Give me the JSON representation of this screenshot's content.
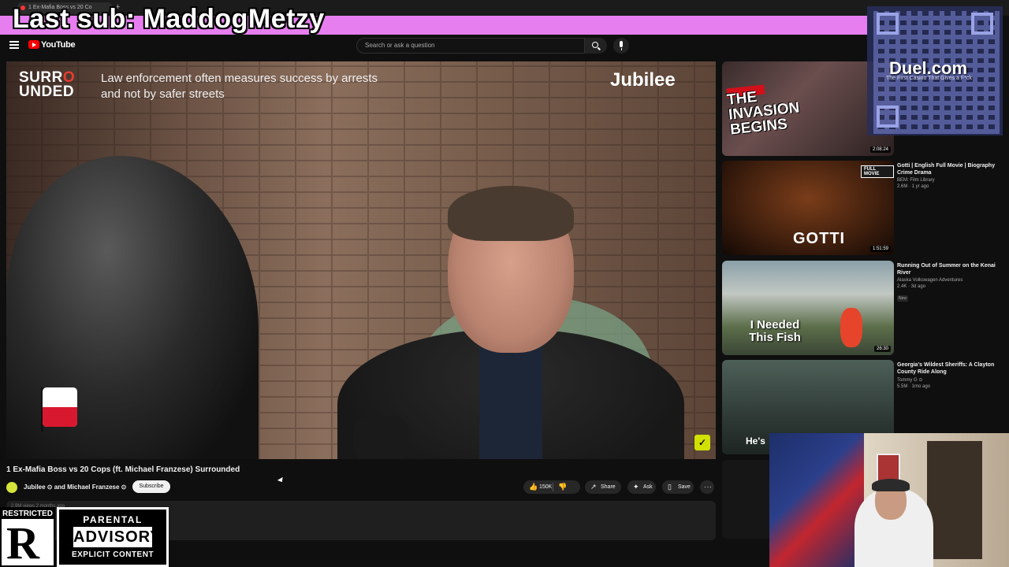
{
  "browser": {
    "tab_title": "1 Ex-Mafia Boss vs 20 Co",
    "new_tab_glyph": "+"
  },
  "stream_banner": {
    "text": "Last sub: MaddogMetzy",
    "color": "#e77ef0"
  },
  "header": {
    "brand": "YouTube",
    "search_placeholder": "Search or ask a question",
    "icons": [
      "menu-icon",
      "youtube-logo-icon",
      "search-icon",
      "mic-icon"
    ]
  },
  "video": {
    "overlay_logo_line1": "SURR",
    "overlay_logo_o": "O",
    "overlay_logo_line2": "UNDED",
    "caption": "Law enforcement often measures success by arrests and not by safer streets",
    "watermark": "Jubilee",
    "badge_glyph": "✓",
    "title": "1 Ex-Mafia Boss vs 20 Cops (ft. Michael Franzese) Surrounded",
    "channel": "Jubilee ⊙ and Michael Franzese ⊙",
    "subscribe_label": "Subscribe",
    "likes": "150K",
    "share_label": "Share",
    "ask_label": "Ask",
    "save_label": "Save",
    "more_glyph": "···",
    "description_preview": "2.9M views  2 months ago"
  },
  "sidebar": {
    "items": [
      {
        "thumb_text": "THE INVASION BEGINS",
        "thumb_tag": "STORY OF",
        "duration": "2:08:24",
        "title": "",
        "channel": "",
        "stats": ""
      },
      {
        "thumb_text": "GOTTI",
        "thumb_badge": "FULL MOVIE",
        "duration": "1:51:59",
        "title": "Gotti | English Full Movie | Biography Crime Drama",
        "channel": "BEM: Film Library",
        "stats": "2.6M · 1 yr ago"
      },
      {
        "thumb_text": "I Needed This Fish",
        "duration": "26:30",
        "title": "Running Out of Summer on the Kenai River",
        "channel": "Alaska Volkswagen Adventures",
        "stats": "2.4K · 3d ago",
        "badge": "New"
      },
      {
        "thumb_text": "He's",
        "duration": "",
        "title": "Georgia's Wildest Sheriffs: A Clayton County Ride Along",
        "channel": "Tommy G ⊙",
        "stats": "5.5M · 1mo ago"
      }
    ]
  },
  "overlay": {
    "sponsor": "Duel.com",
    "sponsor_tagline": "The First Casino That Gives a F*ck"
  },
  "rating": {
    "restricted_label": "RESTRICTED",
    "restricted_letter": "R",
    "advisory_top": "PARENTAL",
    "advisory_mid": "ADVISORY",
    "advisory_bot": "EXPLICIT CONTENT"
  }
}
